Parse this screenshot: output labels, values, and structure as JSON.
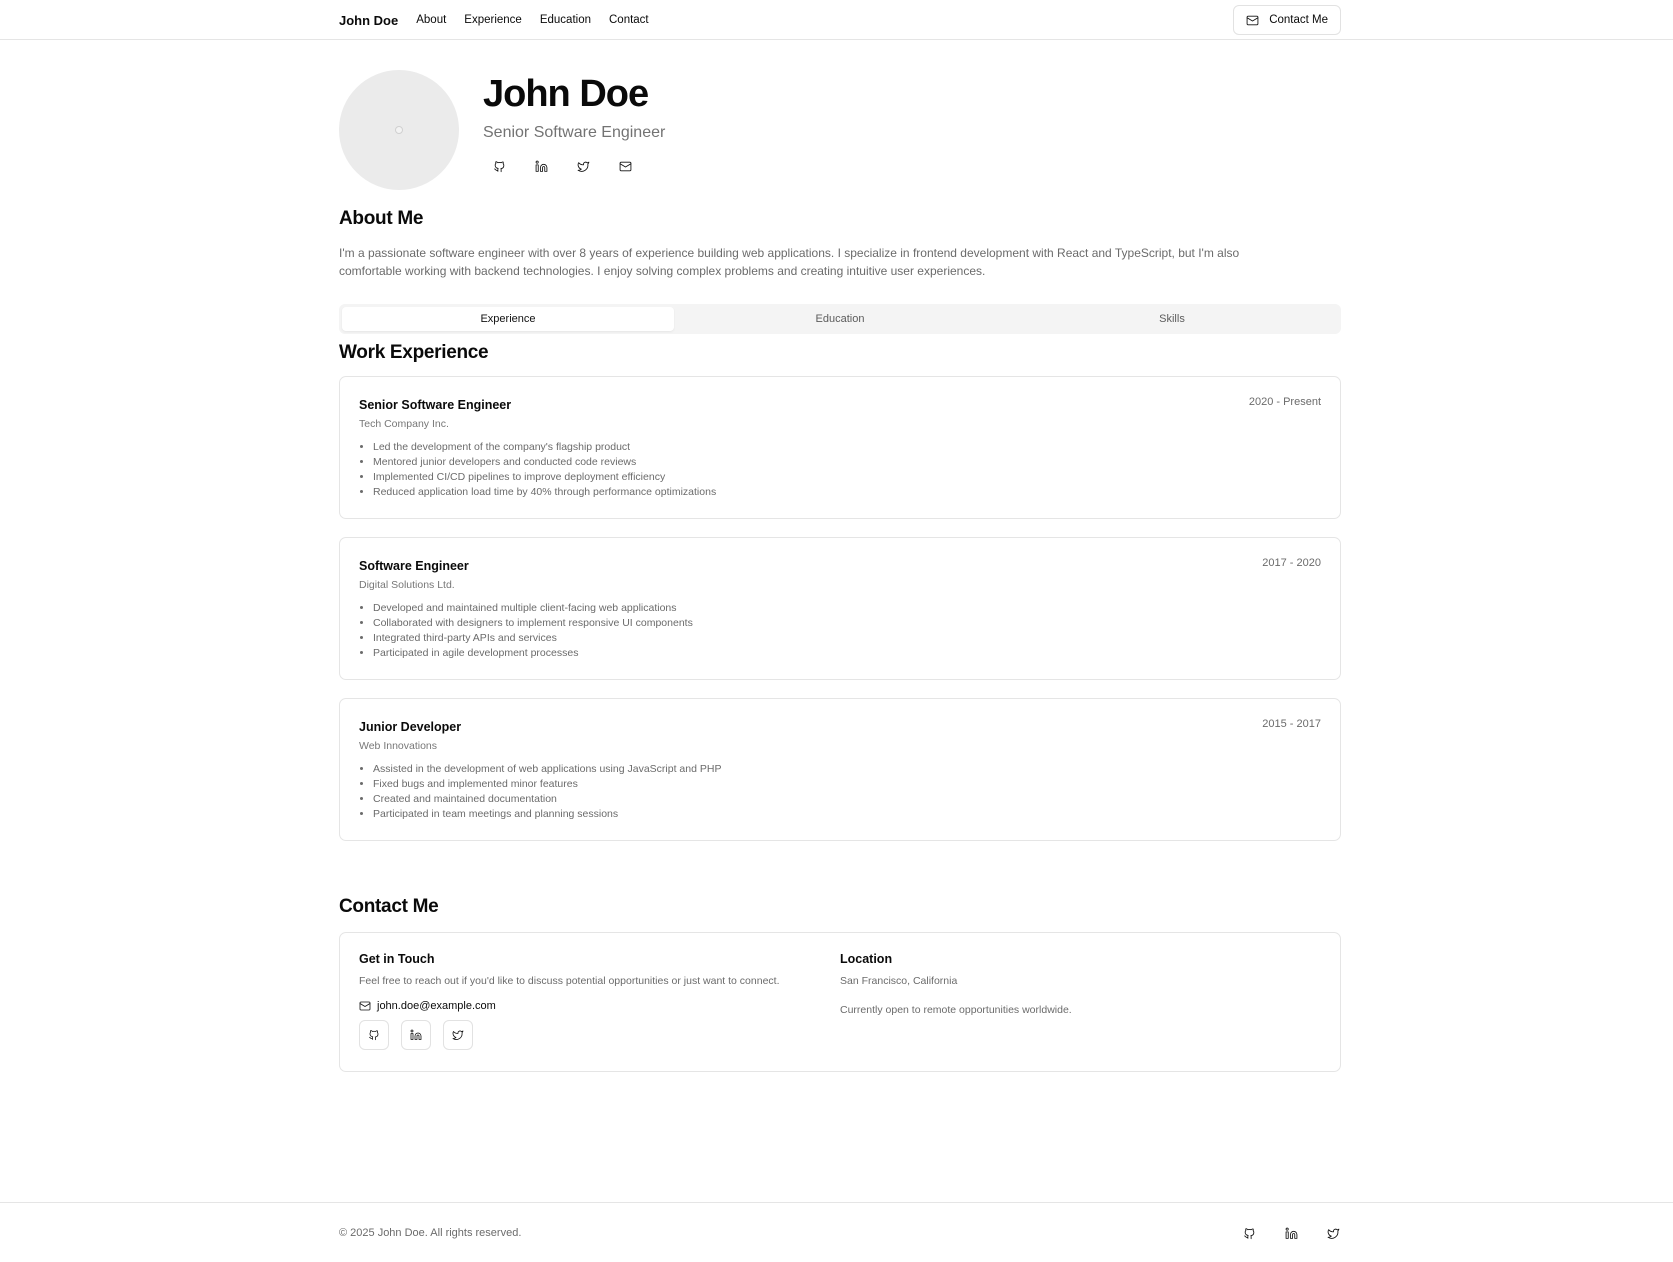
{
  "nav": {
    "brand": "John Doe",
    "links": [
      "About",
      "Experience",
      "Education",
      "Contact"
    ],
    "contact_button": "Contact Me"
  },
  "hero": {
    "name": "John Doe",
    "title": "Senior Software Engineer",
    "social_icons": [
      "github-icon",
      "linkedin-icon",
      "twitter-icon",
      "mail-icon"
    ]
  },
  "about": {
    "heading": "About Me",
    "text": "I'm a passionate software engineer with over 8 years of experience building web applications. I specialize in frontend development with React and TypeScript, but I'm also comfortable working with backend technologies. I enjoy solving complex problems and creating intuitive user experiences."
  },
  "tabs": [
    {
      "label": "Experience",
      "active": true
    },
    {
      "label": "Education",
      "active": false
    },
    {
      "label": "Skills",
      "active": false
    }
  ],
  "work": {
    "heading": "Work Experience",
    "jobs": [
      {
        "role": "Senior Software Engineer",
        "company": "Tech Company Inc.",
        "period": "2020 - Present",
        "bullets": [
          "Led the development of the company's flagship product",
          "Mentored junior developers and conducted code reviews",
          "Implemented CI/CD pipelines to improve deployment efficiency",
          "Reduced application load time by 40% through performance optimizations"
        ]
      },
      {
        "role": "Software Engineer",
        "company": "Digital Solutions Ltd.",
        "period": "2017 - 2020",
        "bullets": [
          "Developed and maintained multiple client-facing web applications",
          "Collaborated with designers to implement responsive UI components",
          "Integrated third-party APIs and services",
          "Participated in agile development processes"
        ]
      },
      {
        "role": "Junior Developer",
        "company": "Web Innovations",
        "period": "2015 - 2017",
        "bullets": [
          "Assisted in the development of web applications using JavaScript and PHP",
          "Fixed bugs and implemented minor features",
          "Created and maintained documentation",
          "Participated in team meetings and planning sessions"
        ]
      }
    ]
  },
  "contact": {
    "heading": "Contact Me",
    "get_in_touch": {
      "heading": "Get in Touch",
      "text": "Feel free to reach out if you'd like to discuss potential opportunities or just want to connect.",
      "email": "john.doe@example.com",
      "social_icons": [
        "github-icon",
        "linkedin-icon",
        "twitter-icon"
      ]
    },
    "location": {
      "heading": "Location",
      "city": "San Francisco, California",
      "note": "Currently open to remote opportunities worldwide."
    }
  },
  "footer": {
    "copyright": "© 2025 John Doe. All rights reserved.",
    "social_icons": [
      "github-icon",
      "linkedin-icon",
      "twitter-icon"
    ]
  }
}
